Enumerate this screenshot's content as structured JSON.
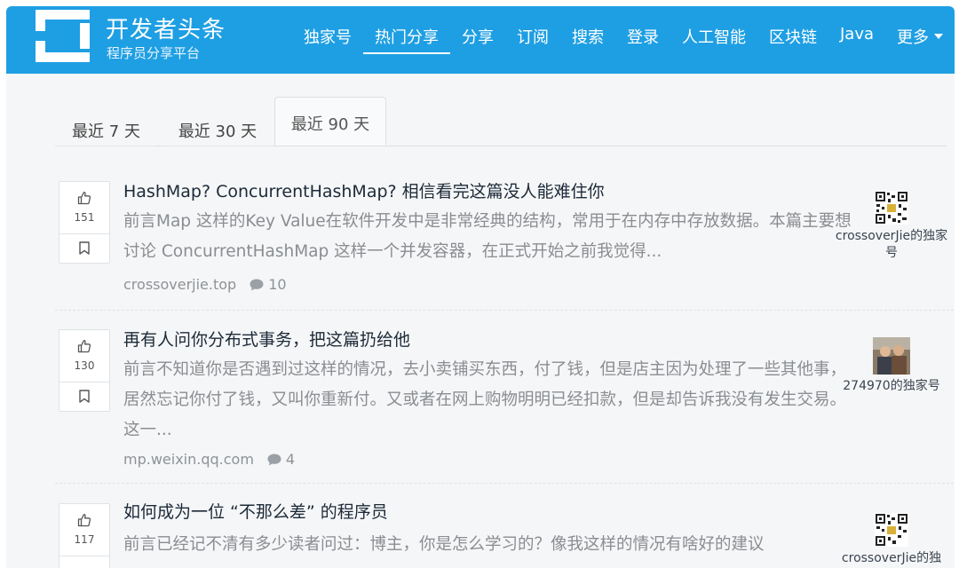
{
  "brand": {
    "title": "开发者头条",
    "subtitle": "程序员分享平台"
  },
  "nav": [
    {
      "label": "独家号"
    },
    {
      "label": "热门分享",
      "active": true
    },
    {
      "label": "分享"
    },
    {
      "label": "订阅"
    },
    {
      "label": "搜索"
    },
    {
      "label": "登录"
    },
    {
      "label": "人工智能"
    },
    {
      "label": "区块链"
    },
    {
      "label": "Java"
    },
    {
      "label": "更多"
    }
  ],
  "tabs": [
    {
      "label": "最近 7 天"
    },
    {
      "label": "最近 30 天"
    },
    {
      "label": "最近 90 天",
      "active": true
    }
  ],
  "articles": [
    {
      "votes": "151",
      "title": "HashMap? ConcurrentHashMap? 相信看完这篇没人能难住你",
      "summary": "前言Map 这样的Key Value在软件开发中是非常经典的结构，常用于在内存中存放数据。本篇主要想讨论 ConcurrentHashMap 这样一个并发容器，在正式开始之前我觉得...",
      "source": "crossoverjie.top",
      "comments": "10",
      "column_name": "crossoverJie的独家号"
    },
    {
      "votes": "130",
      "title": "再有人问你分布式事务，把这篇扔给他",
      "summary": "前言不知道你是否遇到过这样的情况，去小卖铺买东西，付了钱，但是店主因为处理了一些其他事，居然忘记你付了钱，又叫你重新付。又或者在网上购物明明已经扣款，但是却告诉我没有发生交易。这一...",
      "source": "mp.weixin.qq.com",
      "comments": "4",
      "column_name": "274970的独家号"
    },
    {
      "votes": "117",
      "title": "如何成为一位 “不那么差” 的程序员",
      "summary": "前言已经记不清有多少读者问过：博主，你是怎么学习的？像我这样的情况有啥好的建议",
      "source": "",
      "comments": "",
      "column_name": "crossoverJie的独"
    }
  ],
  "colors": {
    "header": "#1f9fe3",
    "page": "#f5f6f7"
  }
}
